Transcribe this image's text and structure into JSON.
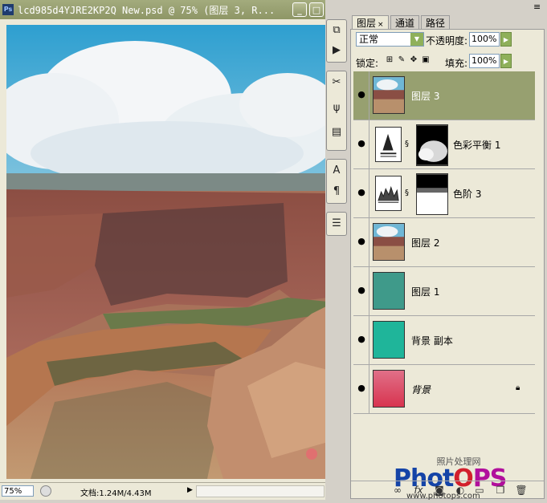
{
  "document": {
    "title": "lcd985d4YJRE2KP2Q New.psd @ 75% (图层 3, R...",
    "app_icon": "Ps",
    "zoom": "75%",
    "doc_size": "文档:1.24M/4.43M"
  },
  "tools": [
    "history-icon",
    "actions-icon",
    "tool-presets-icon",
    "brushes-icon",
    "clone-source-icon",
    "character-icon",
    "paragraph-icon",
    "layer-comps-icon"
  ],
  "panel": {
    "tabs": [
      "图层",
      "通道",
      "路径"
    ],
    "blend_mode": "正常",
    "opacity_label": "不透明度:",
    "opacity": "100%",
    "lock_label": "锁定:",
    "fill_label": "填充:",
    "fill": "100%",
    "layers": [
      {
        "name": "图层 3",
        "selected": true,
        "type": "image"
      },
      {
        "name": "色彩平衡 1",
        "selected": false,
        "type": "adjustment"
      },
      {
        "name": "色阶 3",
        "selected": false,
        "type": "adjustment"
      },
      {
        "name": "图层 2",
        "selected": false,
        "type": "image"
      },
      {
        "name": "图层 1",
        "selected": false,
        "type": "fill",
        "color": "#3f9a8a"
      },
      {
        "name": "背景 副本",
        "selected": false,
        "type": "fill",
        "color": "#1fb59a"
      },
      {
        "name": "背景",
        "selected": false,
        "type": "fill",
        "color": "#d8344f",
        "locked": true
      }
    ]
  },
  "watermark": {
    "top": "照片处理网",
    "logo_a": "Phot",
    "logo_b": "O",
    "logo_c": "PS",
    "url": "www.photops.com"
  },
  "colors": {
    "titlebar": "#8e9666",
    "selected_layer": "#97a070",
    "accent_button": "#8fb05a"
  }
}
